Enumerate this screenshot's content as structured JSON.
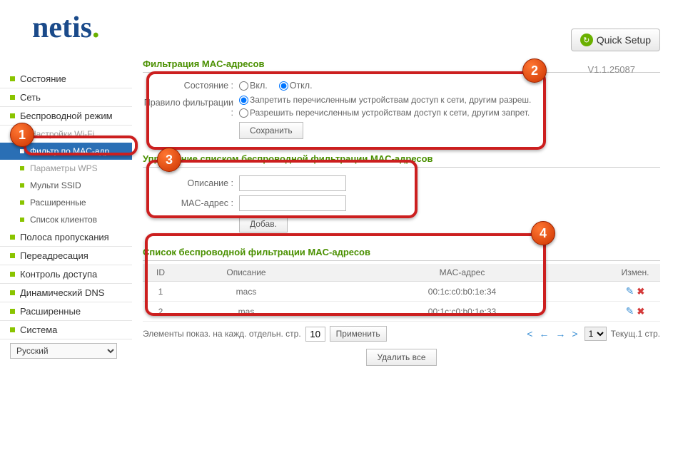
{
  "header": {
    "logo_main": "netis",
    "quick_setup": "Quick Setup",
    "version": "V1.1.25087"
  },
  "sidebar": {
    "items": [
      {
        "label": "Состояние"
      },
      {
        "label": "Сеть"
      },
      {
        "label": "Беспроводной режим"
      },
      {
        "label": "Настройки Wi-Fi",
        "sub": true,
        "dim": true
      },
      {
        "label": "Фильтр по MAC-адр.",
        "sub": true,
        "active": true
      },
      {
        "label": "Параметры WPS",
        "sub": true,
        "dim": true
      },
      {
        "label": "Мульти SSID",
        "sub": true
      },
      {
        "label": "Расширенные",
        "sub": true
      },
      {
        "label": "Список клиентов",
        "sub": true
      },
      {
        "label": "Полоса пропускания"
      },
      {
        "label": "Переадресация"
      },
      {
        "label": "Контроль доступа"
      },
      {
        "label": "Динамический DNS"
      },
      {
        "label": "Расширенные"
      },
      {
        "label": "Система"
      }
    ],
    "lang": "Русский"
  },
  "section1": {
    "title": "Фильтрация MAC-адресов",
    "state_label": "Состояние :",
    "state_on": "Вкл.",
    "state_off": "Откл.",
    "rule_label": "Правило фильтрации :",
    "rule_deny": "Запретить перечисленным устройствам доступ к сети, другим разреш.",
    "rule_allow": "Разрешить перечисленным устройствам доступ к сети, другим запрет.",
    "save": "Сохранить"
  },
  "section2": {
    "title": "Управление списком беспроводной фильтрации MAC-адресов",
    "desc_label": "Описание :",
    "mac_label": "MAC-адрес :",
    "add": "Добав."
  },
  "section3": {
    "title": "Список беспроводной фильтрации MAC-адресов",
    "col_id": "ID",
    "col_desc": "Описание",
    "col_mac": "MAC-адрес",
    "col_mod": "Измен.",
    "rows": [
      {
        "id": "1",
        "desc": "macs",
        "mac": "00:1c:c0:b0:1e:34"
      },
      {
        "id": "2",
        "desc": "mas",
        "mac": "00:1c:c0:b0:1e:33"
      }
    ],
    "pager_txt": "Элементы показ. на кажд. отдельн. стр.",
    "per_page": "10",
    "apply": "Применить",
    "page_sel": "1",
    "cur_page": "Текущ.1 стр.",
    "del_all": "Удалить все"
  },
  "badges": {
    "b1": "1",
    "b2": "2",
    "b3": "3",
    "b4": "4"
  }
}
